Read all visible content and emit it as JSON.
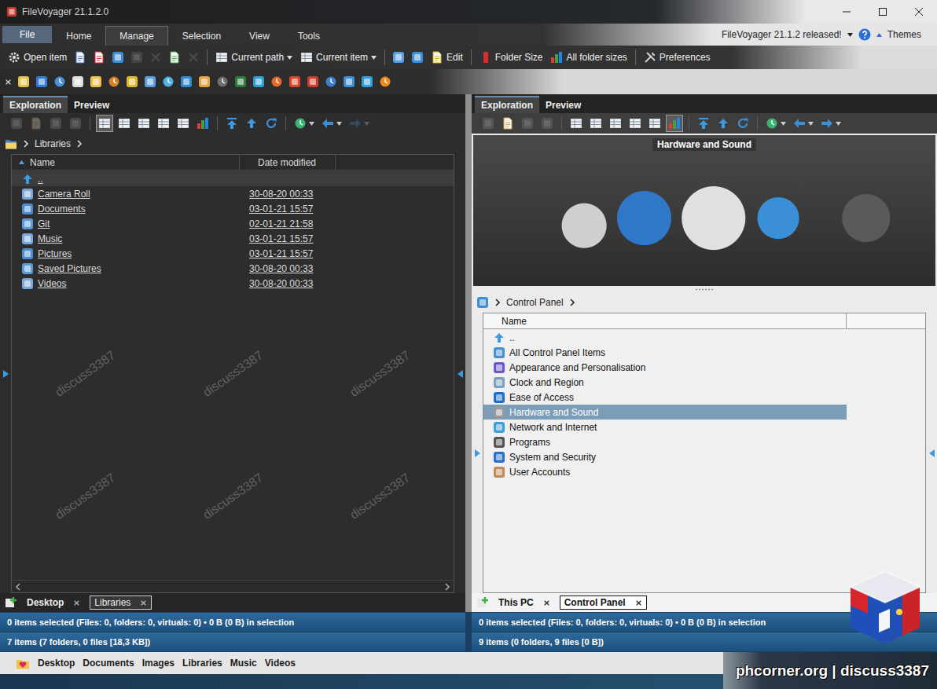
{
  "window": {
    "title": "FileVoyager 21.1.2.0"
  },
  "menu": {
    "items": [
      {
        "label": "File",
        "kind": "button",
        "selected": false
      },
      {
        "label": "Home",
        "kind": "tab",
        "selected": false
      },
      {
        "label": "Manage",
        "kind": "tab",
        "selected": true
      },
      {
        "label": "Selection",
        "kind": "tab",
        "selected": false
      },
      {
        "label": "View",
        "kind": "tab",
        "selected": false
      },
      {
        "label": "Tools",
        "kind": "tab",
        "selected": false
      }
    ],
    "notice": "FileVoyager 21.1.2 released!",
    "themes": "Themes"
  },
  "ribbon": [
    {
      "kind": "labeled",
      "label": "Open item",
      "dropdown": false,
      "disabled": false
    },
    {
      "kind": "icon",
      "disabled": false
    },
    {
      "kind": "icon",
      "disabled": false
    },
    {
      "kind": "icon",
      "disabled": false
    },
    {
      "kind": "icon",
      "disabled": true
    },
    {
      "kind": "icon",
      "disabled": true
    },
    {
      "kind": "icon",
      "disabled": false
    },
    {
      "kind": "icon",
      "disabled": true
    },
    {
      "kind": "separator"
    },
    {
      "kind": "labeled",
      "label": "Current path",
      "dropdown": true,
      "disabled": false
    },
    {
      "kind": "labeled",
      "label": "Current item",
      "dropdown": true,
      "disabled": false
    },
    {
      "kind": "separator"
    },
    {
      "kind": "icon",
      "disabled": false
    },
    {
      "kind": "icon",
      "disabled": false
    },
    {
      "kind": "labeled",
      "label": "Edit",
      "dropdown": false,
      "disabled": false
    },
    {
      "kind": "separator"
    },
    {
      "kind": "labeled",
      "label": "Folder Size",
      "dropdown": false,
      "disabled": false
    },
    {
      "kind": "labeled",
      "label": "All folder sizes",
      "dropdown": false,
      "disabled": false
    },
    {
      "kind": "separator"
    },
    {
      "kind": "labeled",
      "label": "Preferences",
      "dropdown": false,
      "disabled": false
    }
  ],
  "left_pane": {
    "tabs": [
      {
        "label": "Exploration",
        "selected": true
      },
      {
        "label": "Preview",
        "selected": false
      }
    ],
    "toolbar": [
      {
        "kind": "icon",
        "disabled": true,
        "selected": false
      },
      {
        "kind": "icon",
        "disabled": true,
        "selected": false
      },
      {
        "kind": "icon",
        "disabled": true,
        "selected": false
      },
      {
        "kind": "icon",
        "disabled": true,
        "selected": false
      },
      {
        "kind": "separator"
      },
      {
        "kind": "icon",
        "disabled": false,
        "selected": true
      },
      {
        "kind": "icon",
        "disabled": false,
        "selected": false
      },
      {
        "kind": "icon",
        "disabled": false,
        "selected": false
      },
      {
        "kind": "icon",
        "disabled": false,
        "selected": false
      },
      {
        "kind": "icon",
        "disabled": false,
        "selected": false
      },
      {
        "kind": "icon",
        "disabled": false,
        "selected": false
      },
      {
        "kind": "separator"
      },
      {
        "kind": "icon",
        "disabled": false,
        "selected": false
      },
      {
        "kind": "icon",
        "disabled": false,
        "selected": false
      },
      {
        "kind": "icon",
        "disabled": false,
        "selected": false
      },
      {
        "kind": "separator"
      },
      {
        "kind": "dropdown",
        "disabled": false,
        "selected": false
      },
      {
        "kind": "dropdown",
        "disabled": false,
        "selected": false
      },
      {
        "kind": "dropdown",
        "disabled": true,
        "selected": false
      }
    ],
    "breadcrumb": [
      "Libraries"
    ],
    "columns": [
      {
        "label": "Name",
        "sorted": true
      },
      {
        "label": "Date modified",
        "sorted": false
      }
    ],
    "rows": [
      {
        "name": "..",
        "date": "",
        "selected": false,
        "focused": true
      },
      {
        "name": "Camera Roll",
        "date": "30-08-20 00:33",
        "selected": false,
        "focused": false
      },
      {
        "name": "Documents",
        "date": "03-01-21 15:57",
        "selected": false,
        "focused": false
      },
      {
        "name": "Git",
        "date": "02-01-21 21:58",
        "selected": false,
        "focused": false
      },
      {
        "name": "Music",
        "date": "03-01-21 15:57",
        "selected": false,
        "focused": false
      },
      {
        "name": "Pictures",
        "date": "03-01-21 15:57",
        "selected": false,
        "focused": false
      },
      {
        "name": "Saved Pictures",
        "date": "30-08-20 00:33",
        "selected": false,
        "focused": false
      },
      {
        "name": "Videos",
        "date": "30-08-20 00:33",
        "selected": false,
        "focused": false
      }
    ],
    "doc_tabs": [
      {
        "label": "Desktop",
        "selected": false
      },
      {
        "label": "Libraries",
        "selected": true
      }
    ],
    "status": [
      "0 items selected (Files: 0, folders: 0, virtuals: 0) • 0 B (0 B) in selection",
      "7 items (7 folders, 0 files [18,3 KB])"
    ]
  },
  "right_pane": {
    "tabs": [
      {
        "label": "Exploration",
        "selected": true
      },
      {
        "label": "Preview",
        "selected": false
      }
    ],
    "toolbar": [
      {
        "kind": "icon",
        "disabled": true,
        "selected": false
      },
      {
        "kind": "icon",
        "disabled": false,
        "selected": false
      },
      {
        "kind": "icon",
        "disabled": true,
        "selected": false
      },
      {
        "kind": "icon",
        "disabled": true,
        "selected": false
      },
      {
        "kind": "separator"
      },
      {
        "kind": "icon",
        "disabled": false,
        "selected": false
      },
      {
        "kind": "icon",
        "disabled": false,
        "selected": false
      },
      {
        "kind": "icon",
        "disabled": false,
        "selected": false
      },
      {
        "kind": "icon",
        "disabled": false,
        "selected": false
      },
      {
        "kind": "icon",
        "disabled": false,
        "selected": false
      },
      {
        "kind": "icon",
        "disabled": false,
        "selected": true
      },
      {
        "kind": "separator"
      },
      {
        "kind": "icon",
        "disabled": false,
        "selected": false
      },
      {
        "kind": "icon",
        "disabled": false,
        "selected": false
      },
      {
        "kind": "icon",
        "disabled": false,
        "selected": false
      },
      {
        "kind": "separator"
      },
      {
        "kind": "dropdown",
        "disabled": false,
        "selected": false
      },
      {
        "kind": "dropdown",
        "disabled": false,
        "selected": false
      },
      {
        "kind": "dropdown",
        "disabled": false,
        "selected": false
      }
    ],
    "preview": {
      "title": "Hardware and Sound"
    },
    "breadcrumb": [
      "Control Panel"
    ],
    "columns": [
      {
        "label": "Name",
        "sorted": false
      }
    ],
    "rows": [
      {
        "name": "..",
        "selected": false,
        "focused": false
      },
      {
        "name": "All Control Panel Items",
        "selected": false,
        "focused": false
      },
      {
        "name": "Appearance and Personalisation",
        "selected": false,
        "focused": false
      },
      {
        "name": "Clock and Region",
        "selected": false,
        "focused": false
      },
      {
        "name": "Ease of Access",
        "selected": false,
        "focused": false
      },
      {
        "name": "Hardware and Sound",
        "selected": true,
        "focused": false
      },
      {
        "name": "Network and Internet",
        "selected": false,
        "focused": false
      },
      {
        "name": "Programs",
        "selected": false,
        "focused": false
      },
      {
        "name": "System and Security",
        "selected": false,
        "focused": false
      },
      {
        "name": "User Accounts",
        "selected": false,
        "focused": false
      }
    ],
    "doc_tabs": [
      {
        "label": "This PC",
        "selected": false
      },
      {
        "label": "Control Panel",
        "selected": true
      }
    ],
    "status": [
      "0 items selected (Files: 0, folders: 0, virtuals: 0) • 0 B (0 B) in selection",
      "9 items (0 folders, 9 files [0 B])"
    ]
  },
  "bottom_bar": {
    "folders": [
      "Desktop",
      "Documents",
      "Images",
      "Libraries",
      "Music",
      "Videos"
    ]
  },
  "branding": {
    "site": "phcorner.org | discuss3387",
    "watermark": "discuss3387"
  }
}
